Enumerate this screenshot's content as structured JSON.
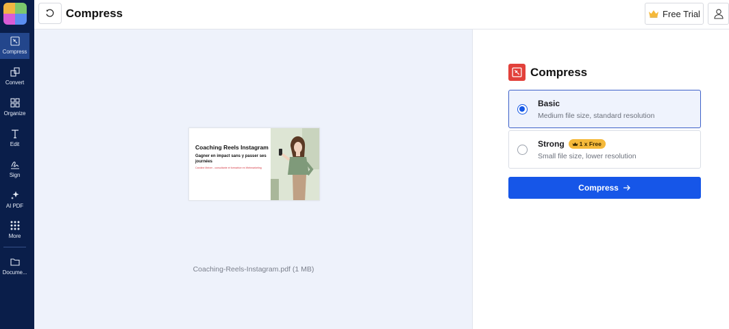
{
  "app": {
    "logo_colors": [
      "#f0b542",
      "#7bc86c",
      "#d95cd6",
      "#5b8ef0"
    ]
  },
  "sidebar": {
    "items": [
      {
        "label": "Compress",
        "icon": "compress-icon"
      },
      {
        "label": "Convert",
        "icon": "convert-icon"
      },
      {
        "label": "Organize",
        "icon": "grid-icon"
      },
      {
        "label": "Edit",
        "icon": "text-edit-icon"
      },
      {
        "label": "Sign",
        "icon": "signature-icon"
      },
      {
        "label": "AI PDF",
        "icon": "sparkle-icon"
      },
      {
        "label": "More",
        "icon": "dots-grid-icon"
      },
      {
        "label": "Docume...",
        "icon": "folder-icon"
      }
    ],
    "active": "Compress"
  },
  "header": {
    "title": "Compress",
    "trial_label": "Free Trial"
  },
  "preview": {
    "thumbnail": {
      "title": "Coaching Reels Instagram",
      "subtitle": "Gagner en impact sans y passer ses journées",
      "author_line": "Caroline Meixer - consultante et formatrice en Webmarketing"
    },
    "file_label": "Coaching-Reels-Instagram.pdf (1 MB)"
  },
  "panel": {
    "title": "Compress",
    "options": [
      {
        "name": "Basic",
        "description": "Medium file size, standard resolution",
        "selected": true
      },
      {
        "name": "Strong",
        "description": "Small file size, lower resolution",
        "badge": "1 x Free",
        "selected": false
      }
    ],
    "action_label": "Compress"
  },
  "colors": {
    "sidebar_bg": "#0a1e4a",
    "accent_blue": "#1656e8",
    "compress_red": "#e2413b",
    "badge_gold": "#f5b93a"
  }
}
